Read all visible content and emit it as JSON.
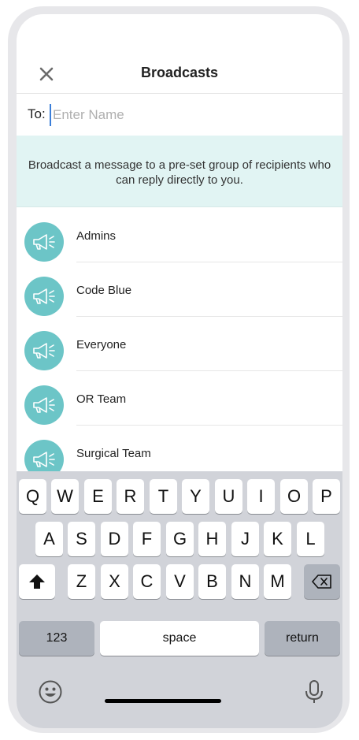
{
  "header": {
    "title": "Broadcasts",
    "close_icon": "close-icon"
  },
  "to_field": {
    "label": "To:",
    "placeholder": "Enter Name",
    "value": ""
  },
  "banner": {
    "text": "Broadcast a message to a pre-set group of recipients who can reply directly to you."
  },
  "broadcast_list": [
    {
      "label": "Admins",
      "icon": "megaphone-icon"
    },
    {
      "label": "Code Blue",
      "icon": "megaphone-icon"
    },
    {
      "label": "Everyone",
      "icon": "megaphone-icon"
    },
    {
      "label": "OR Team",
      "icon": "megaphone-icon"
    },
    {
      "label": "Surgical Team",
      "icon": "megaphone-icon"
    }
  ],
  "keyboard": {
    "row1": [
      "Q",
      "W",
      "E",
      "R",
      "T",
      "Y",
      "U",
      "I",
      "O",
      "P"
    ],
    "row2": [
      "A",
      "S",
      "D",
      "F",
      "G",
      "H",
      "J",
      "K",
      "L"
    ],
    "row3": [
      "Z",
      "X",
      "C",
      "V",
      "B",
      "N",
      "M"
    ],
    "numbers_label": "123",
    "space_label": "space",
    "return_label": "return"
  },
  "colors": {
    "accent_teal": "#6cc5c7",
    "banner_bg": "#e1f4f3",
    "cursor_blue": "#3b7ed8"
  }
}
